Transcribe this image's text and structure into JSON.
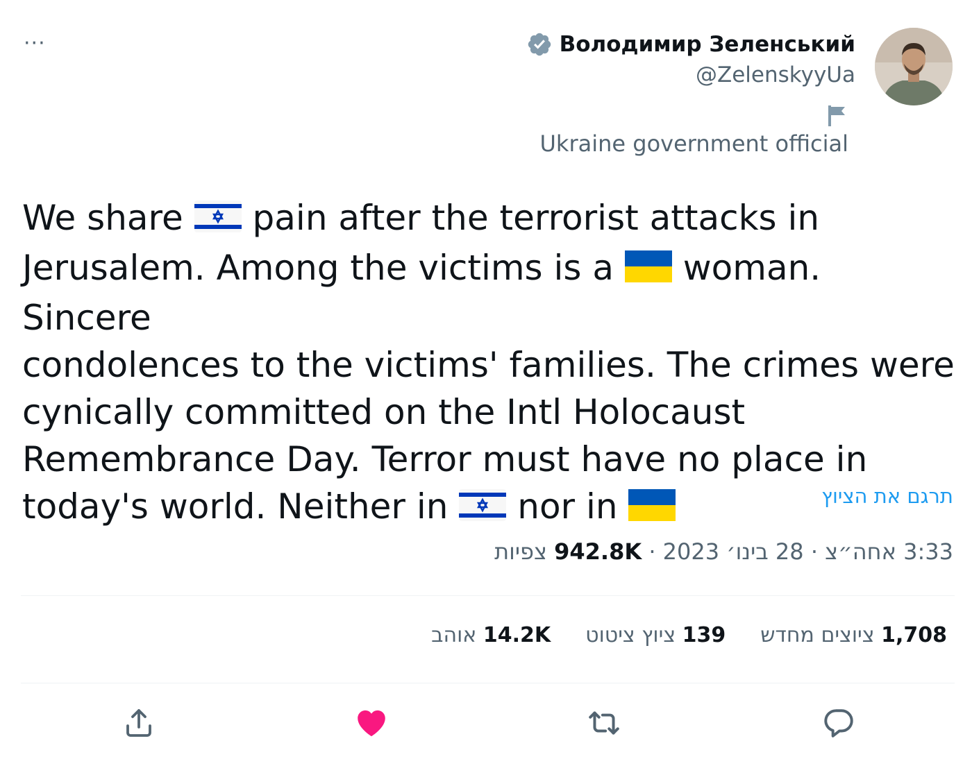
{
  "more_label": "···",
  "author": {
    "name": "Володимир Зеленський",
    "handle": "@ZelenskyyUa",
    "affiliation": "Ukraine government official"
  },
  "tweet": {
    "line1_a": "We share ",
    "line1_b": " pain after the terrorist attacks in",
    "line2_a": "Jerusalem. Among the victims is a ",
    "line2_b": " woman. Sincere",
    "line3": "condolences to the victims' families. The crimes were",
    "line4": "cynically committed on the Intl Holocaust",
    "line5": "Remembrance Day. Terror must have no place in",
    "line6_a": "today's world. Neither in ",
    "line6_b": " nor in "
  },
  "translate_label": "תרגם את הציוץ",
  "meta": {
    "time": "3:33 אחה״צ",
    "sep": " · ",
    "date": "28 בינו׳ 2023",
    "views_count": "942.8K",
    "views_label": "צפיות"
  },
  "stats": {
    "retweets_count": "1,708",
    "retweets_label": "ציוצים מחדש",
    "quotes_count": "139",
    "quotes_label": "ציוץ ציטוט",
    "likes_count": "14.2K",
    "likes_label": "אוהב"
  },
  "colors": {
    "link": "#1d9bf0",
    "like": "#f91880",
    "muted": "#536471",
    "israel_blue": "#0038b8",
    "ukraine_blue": "#0057b7",
    "ukraine_yellow": "#ffd700"
  },
  "icons": {
    "more": "more-icon",
    "verified": "verified-badge-icon",
    "flag": "government-flag-icon",
    "share": "share-icon",
    "like": "heart-icon",
    "retweet": "retweet-icon",
    "reply": "reply-icon"
  }
}
